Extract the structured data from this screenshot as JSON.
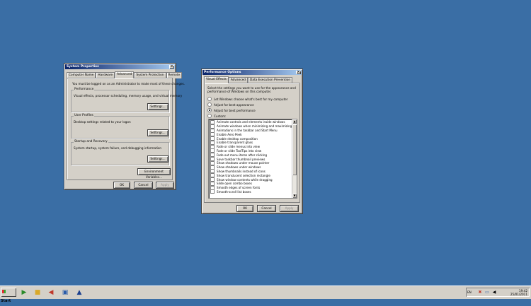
{
  "system_properties": {
    "title": "System Properties",
    "close_glyph": "×",
    "tabs": [
      "Computer Name",
      "Hardware",
      "Advanced",
      "System Protection",
      "Remote"
    ],
    "active_tab": "Advanced",
    "admin_notice": "You must be logged on as an Administrator to make most of these changes.",
    "performance": {
      "title": "Performance",
      "description": "Visual effects, processor scheduling, memory usage, and virtual memory",
      "button": "Settings..."
    },
    "user_profiles": {
      "title": "User Profiles",
      "description": "Desktop settings related to your logon",
      "button": "Settings..."
    },
    "startup_recovery": {
      "title": "Startup and Recovery",
      "description": "System startup, system failure, and debugging information",
      "button": "Settings..."
    },
    "env_button": "Environment Variables...",
    "ok": "OK",
    "cancel": "Cancel",
    "apply": "Apply"
  },
  "performance_options": {
    "title": "Performance Options",
    "close_glyph": "×",
    "tabs": [
      "Visual Effects",
      "Advanced",
      "Data Execution Prevention"
    ],
    "active_tab": "Visual Effects",
    "intro_line1": "Select the settings you want to use for the appearance and",
    "intro_line2": "performance of Windows on this computer.",
    "radios": [
      {
        "label": "Let Windows choose what's best for my computer",
        "selected": false
      },
      {
        "label": "Adjust for best appearance",
        "selected": false
      },
      {
        "label": "Adjust for best performance",
        "selected": true
      },
      {
        "label": "Custom:",
        "selected": false
      }
    ],
    "effects": [
      "Animate controls and elements inside windows",
      "Animate windows when minimizing and maximizing",
      "Animations in the taskbar and Start Menu",
      "Enable Aero Peek",
      "Enable desktop composition",
      "Enable transparent glass",
      "Fade or slide menus into view",
      "Fade or slide ToolTips into view",
      "Fade out menu items after clicking",
      "Save taskbar thumbnail previews",
      "Show shadows under mouse pointer",
      "Show shadows under windows",
      "Show thumbnails instead of icons",
      "Show translucent selection rectangle",
      "Show window contents while dragging",
      "Slide open combo boxes",
      "Smooth edges of screen fonts",
      "Smooth-scroll list boxes"
    ],
    "ok": "OK",
    "cancel": "Cancel",
    "apply": "Apply"
  },
  "taskbar": {
    "start_label": "Start",
    "language": "EN",
    "time": "19:42",
    "date": "25/01/2011"
  },
  "colors": {
    "desktop": "#3a6ea5",
    "title_active": "#0a246a",
    "face": "#d4d0c8"
  }
}
